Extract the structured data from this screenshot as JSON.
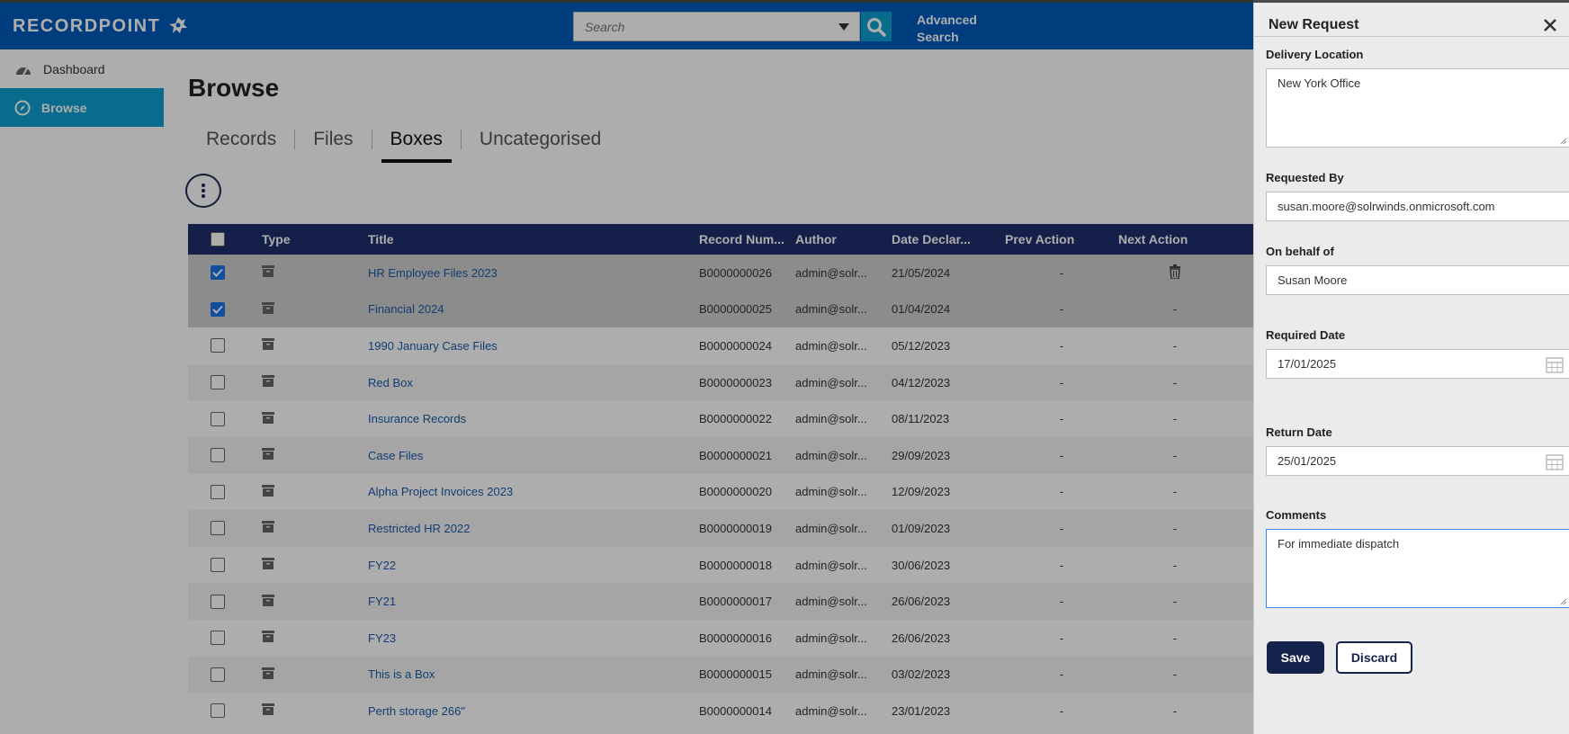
{
  "app": {
    "logo_text": "RECORDPOINT"
  },
  "header": {
    "search_placeholder": "Search",
    "advanced_search": "Advanced Search"
  },
  "sidebar": {
    "items": [
      {
        "label": "Dashboard",
        "icon": "dashboard-icon",
        "active": false
      },
      {
        "label": "Browse",
        "icon": "compass-icon",
        "active": true
      }
    ]
  },
  "main": {
    "title": "Browse",
    "tabs": [
      {
        "label": "Records",
        "active": false
      },
      {
        "label": "Files",
        "active": false
      },
      {
        "label": "Boxes",
        "active": true
      },
      {
        "label": "Uncategorised",
        "active": false
      }
    ]
  },
  "grid": {
    "columns": [
      "Type",
      "Title",
      "Record Num...",
      "Author",
      "Date Declar...",
      "Prev Action",
      "Next Action"
    ],
    "rows": [
      {
        "checked": true,
        "title": "HR Employee Files 2023",
        "number": "B0000000026",
        "author": "admin@solr...",
        "date": "21/05/2024",
        "prev": "-",
        "next": "trash-icon"
      },
      {
        "checked": true,
        "title": "Financial 2024",
        "number": "B0000000025",
        "author": "admin@solr...",
        "date": "01/04/2024",
        "prev": "-",
        "next": "-"
      },
      {
        "checked": false,
        "title": "1990 January Case Files",
        "number": "B0000000024",
        "author": "admin@solr...",
        "date": "05/12/2023",
        "prev": "-",
        "next": "-"
      },
      {
        "checked": false,
        "title": "Red Box",
        "number": "B0000000023",
        "author": "admin@solr...",
        "date": "04/12/2023",
        "prev": "-",
        "next": "-"
      },
      {
        "checked": false,
        "title": "Insurance Records",
        "number": "B0000000022",
        "author": "admin@solr...",
        "date": "08/11/2023",
        "prev": "-",
        "next": "-"
      },
      {
        "checked": false,
        "title": "Case Files",
        "number": "B0000000021",
        "author": "admin@solr...",
        "date": "29/09/2023",
        "prev": "-",
        "next": "-"
      },
      {
        "checked": false,
        "title": "Alpha Project Invoices 2023",
        "number": "B0000000020",
        "author": "admin@solr...",
        "date": "12/09/2023",
        "prev": "-",
        "next": "-"
      },
      {
        "checked": false,
        "title": "Restricted HR 2022",
        "number": "B0000000019",
        "author": "admin@solr...",
        "date": "01/09/2023",
        "prev": "-",
        "next": "-"
      },
      {
        "checked": false,
        "title": "FY22",
        "number": "B0000000018",
        "author": "admin@solr...",
        "date": "30/06/2023",
        "prev": "-",
        "next": "-"
      },
      {
        "checked": false,
        "title": "FY21",
        "number": "B0000000017",
        "author": "admin@solr...",
        "date": "26/06/2023",
        "prev": "-",
        "next": "-"
      },
      {
        "checked": false,
        "title": "FY23",
        "number": "B0000000016",
        "author": "admin@solr...",
        "date": "26/06/2023",
        "prev": "-",
        "next": "-"
      },
      {
        "checked": false,
        "title": "This is a Box",
        "number": "B0000000015",
        "author": "admin@solr...",
        "date": "03/02/2023",
        "prev": "-",
        "next": "-"
      },
      {
        "checked": false,
        "title": "Perth storage 266\"",
        "number": "B0000000014",
        "author": "admin@solr...",
        "date": "23/01/2023",
        "prev": "-",
        "next": "-"
      }
    ]
  },
  "panel": {
    "title": "New Request",
    "delivery_location_label": "Delivery Location",
    "delivery_location_value": "New York Office",
    "requested_by_label": "Requested By",
    "requested_by_value": "susan.moore@solrwinds.onmicrosoft.com",
    "on_behalf_label": "On behalf of",
    "on_behalf_value": "Susan Moore",
    "required_date_label": "Required Date",
    "required_date_value": "17/01/2025",
    "return_date_label": "Return Date",
    "return_date_value": "25/01/2025",
    "comments_label": "Comments",
    "comments_value": "For immediate dispatch",
    "save_label": "Save",
    "discard_label": "Discard"
  },
  "colors": {
    "header_bg": "#005bbb",
    "accent": "#0e9fcf",
    "grid_header": "#1e2e6e",
    "button_dark": "#14234b",
    "link": "#1a5aa8"
  }
}
